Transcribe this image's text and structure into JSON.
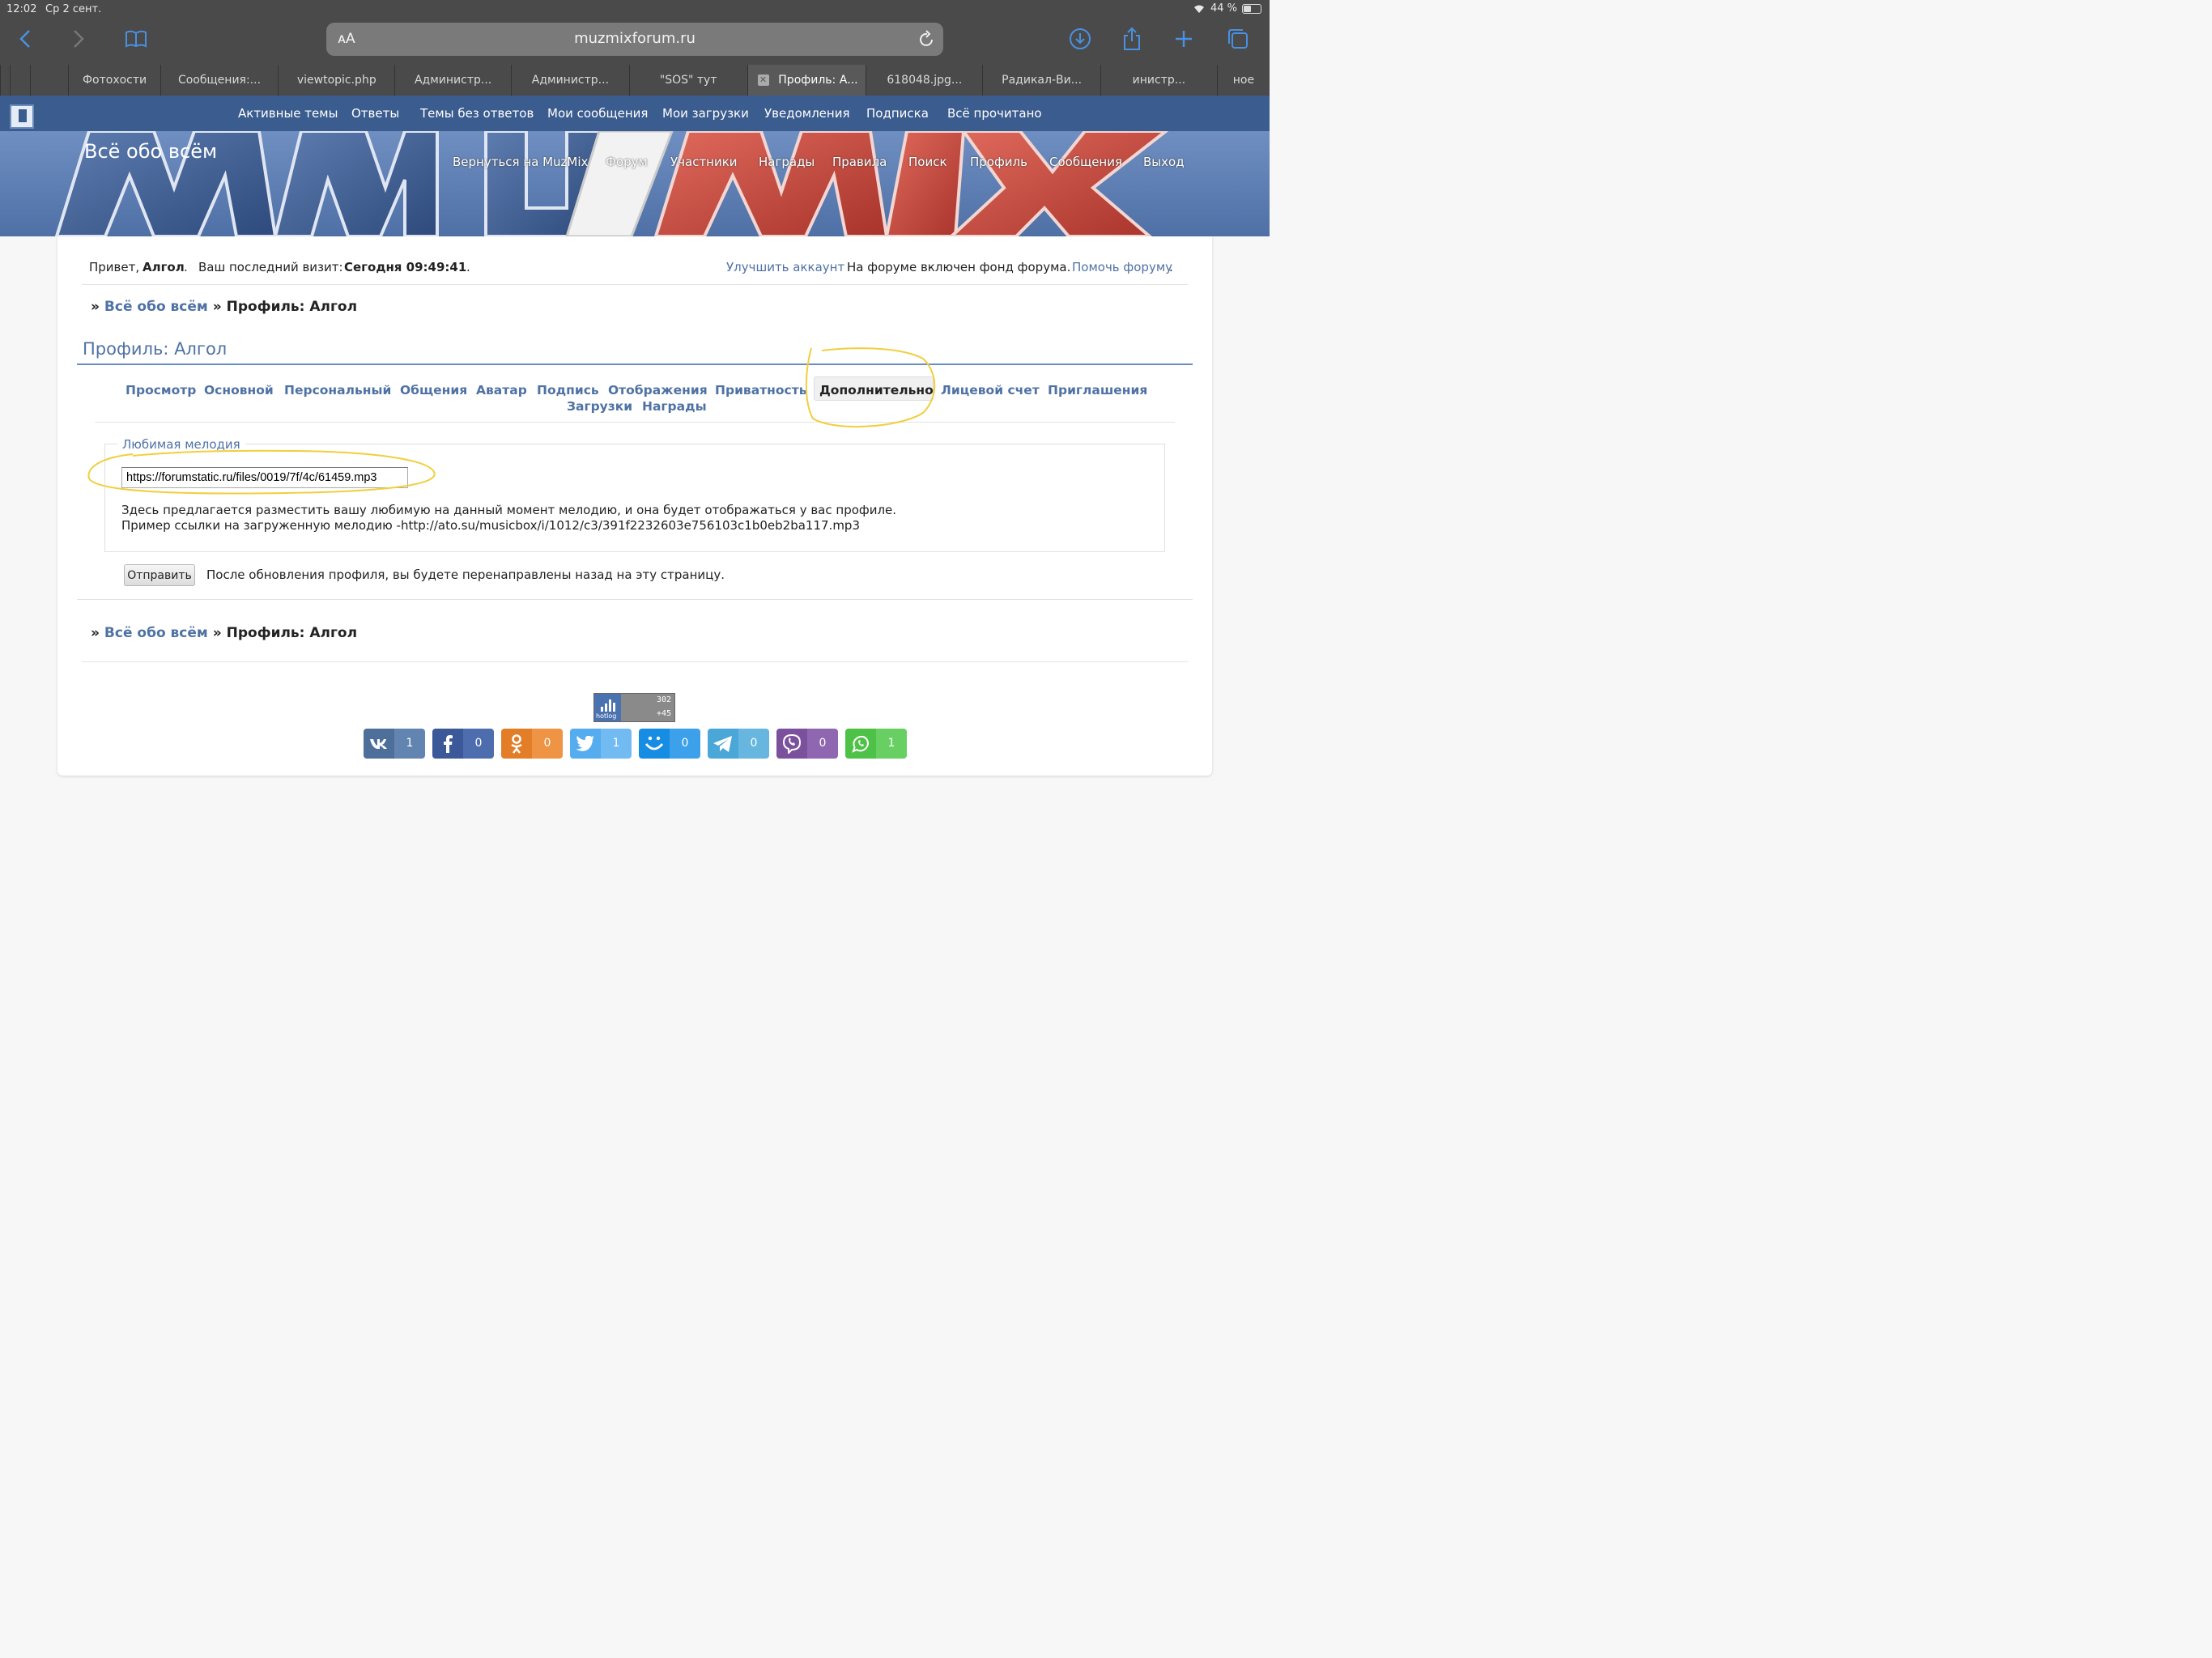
{
  "status_bar": {
    "time": "12:02",
    "date": "Ср 2 сент.",
    "battery": "44 %",
    "battery_level": 0.44
  },
  "browser": {
    "text_size_label": "ᴀA",
    "url": "muzmixforum.ru",
    "tabs": [
      {
        "label": "",
        "active": false
      },
      {
        "label": "",
        "active": false
      },
      {
        "label": "",
        "active": false
      },
      {
        "label": "Фотохости",
        "active": false
      },
      {
        "label": "Сообщения:...",
        "active": false
      },
      {
        "label": "viewtopic.php",
        "active": false
      },
      {
        "label": "Администр...",
        "active": false
      },
      {
        "label": "Администр...",
        "active": false
      },
      {
        "label": "\"SOS\" тут",
        "active": false
      },
      {
        "label": "Профиль: А...",
        "active": true
      },
      {
        "label": "618048.jpg...",
        "active": false
      },
      {
        "label": "Радикал-Ви...",
        "active": false
      },
      {
        "label": "инистр...",
        "active": false
      },
      {
        "label": "ное",
        "active": false
      }
    ],
    "close_tab_glyph": "✕"
  },
  "topnav": [
    "Активные темы",
    "Ответы",
    "Темы без ответов",
    "Мои сообщения",
    "Мои загрузки",
    "Уведомления",
    "Подписка",
    "Всё прочитано"
  ],
  "banner": {
    "title": "Всё обо всём",
    "nav": [
      "Вернуться на MuzMix",
      "Форум",
      "Участники",
      "Награды",
      "Правила",
      "Поиск",
      "Профиль",
      "Сообщения",
      "Выход"
    ]
  },
  "welcome": {
    "greeting": "Привет,",
    "user": "Алгол",
    "dot": ".",
    "visit_label": "Ваш последний визит:",
    "visit_value": "Сегодня 09:49:41",
    "upgrade_link": "Улучшить аккаунт",
    "fund_text": "На форуме включен фонд форума.",
    "help_link": "Помочь форуму",
    "help_dot": "."
  },
  "breadcrumb": {
    "sep": "»",
    "forum": "Всё обо всём",
    "current": "Профиль: Алгол"
  },
  "profile": {
    "title": "Профиль: Алгол",
    "tabs": [
      "Просмотр",
      "Основной",
      "Персональный",
      "Общения",
      "Аватар",
      "Подпись",
      "Отображения",
      "Приватность",
      "Дополнительно",
      "Лицевой счет",
      "Приглашения",
      "Загрузки",
      "Награды"
    ],
    "active_tab": "Дополнительно"
  },
  "form": {
    "legend": "Любимая мелодия",
    "melody_value": "https://forumstatic.ru/files/0019/7f/4c/61459.mp3",
    "help_line1": "Здесь предлагается разместить вашу любимую на данный момент мелодию, и она будет отображаться у вас профиле.",
    "help_line2": "Пример ссылки на загруженную мелодию -http://ato.su/musicbox/i/1012/c3/391f2232603e756103c1b0eb2ba117.mp3",
    "submit_label": "Отправить",
    "submit_note": "После обновления профиля, вы будете перенаправлены назад на эту страницу."
  },
  "counter": {
    "label": "hotlog",
    "value1": "302",
    "value2": "+45"
  },
  "share": [
    {
      "name": "vk",
      "icon": "vk-icon",
      "glyph": "vk",
      "count": "1",
      "color": "#4d6f99",
      "count_color": "#6284b0"
    },
    {
      "name": "facebook",
      "icon": "facebook-icon",
      "glyph": "f",
      "count": "0",
      "color": "#3b5998",
      "count_color": "#4e6daf"
    },
    {
      "name": "odnoklassniki",
      "icon": "odnoklassniki-icon",
      "glyph": "ok",
      "count": "0",
      "color": "#e37e28",
      "count_color": "#ee9444"
    },
    {
      "name": "twitter",
      "icon": "twitter-icon",
      "glyph": "tw",
      "count": "1",
      "color": "#55acee",
      "count_color": "#72bbf2"
    },
    {
      "name": "moimir",
      "icon": "moimir-icon",
      "glyph": "@",
      "count": "0",
      "color": "#168de2",
      "count_color": "#3da0ea"
    },
    {
      "name": "telegram",
      "icon": "telegram-icon",
      "glyph": "tg",
      "count": "0",
      "color": "#4ba7d8",
      "count_color": "#66b6e0"
    },
    {
      "name": "viber",
      "icon": "viber-icon",
      "glyph": "vb",
      "count": "0",
      "color": "#7b519d",
      "count_color": "#8f67b0"
    },
    {
      "name": "whatsapp",
      "icon": "whatsapp-icon",
      "glyph": "wa",
      "count": "1",
      "color": "#4dc247",
      "count_color": "#68d062"
    }
  ],
  "colors": {
    "accent": "#4f72a4",
    "nav": "#3b5c8e",
    "chrome": "#4a4a4a",
    "highlight": "#f2d24b"
  }
}
